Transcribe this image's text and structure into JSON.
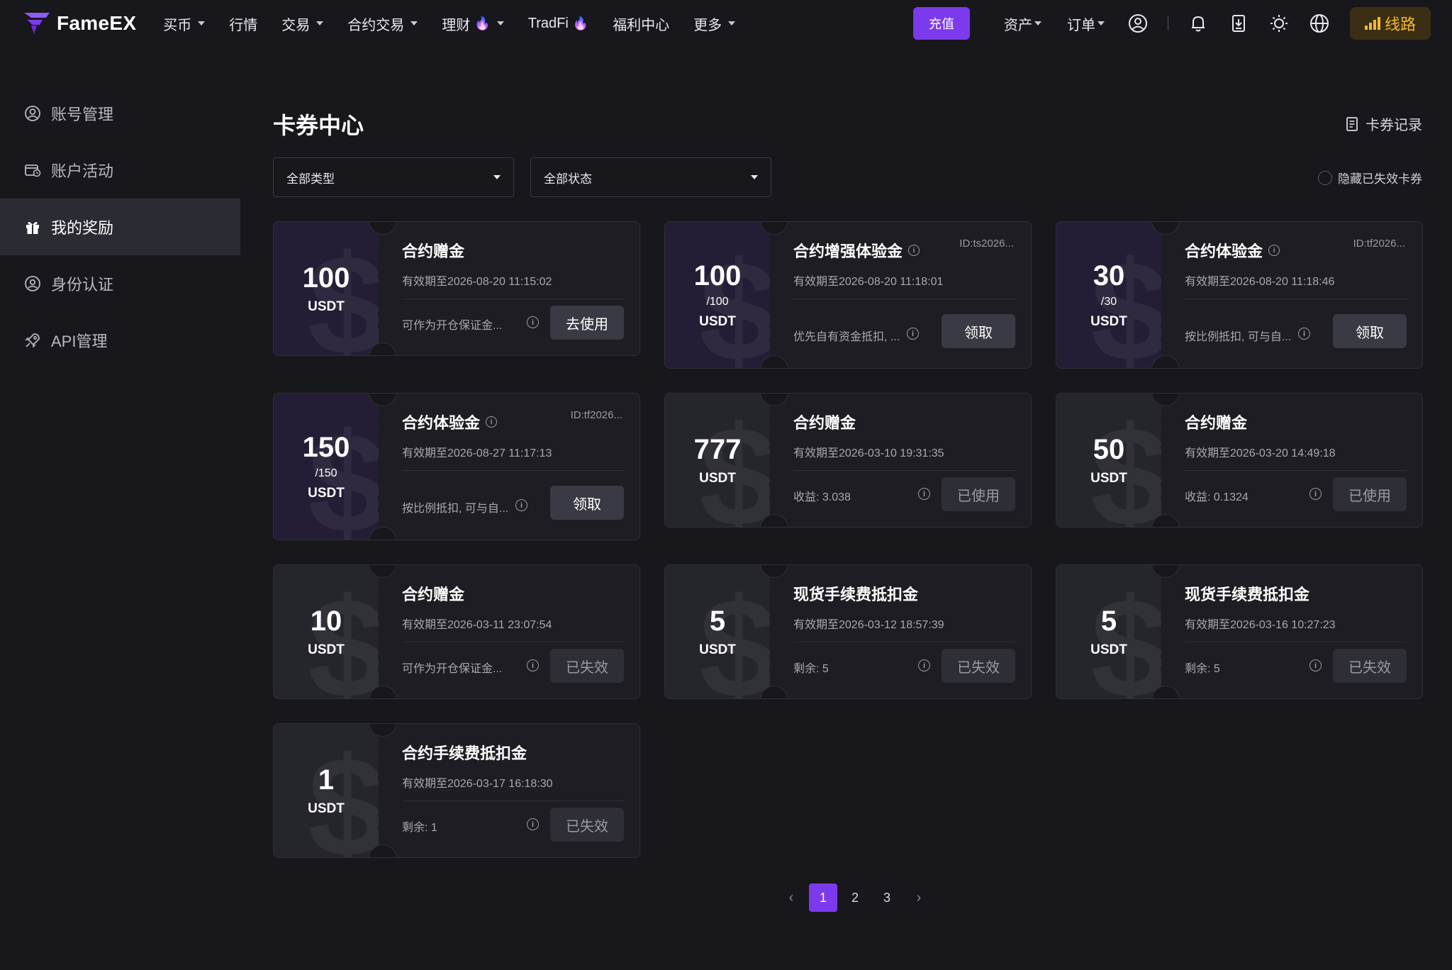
{
  "nav": {
    "logo": "FameEX",
    "items": [
      {
        "label": "买币",
        "caret": true,
        "flame": false
      },
      {
        "label": "行情",
        "caret": false,
        "flame": false
      },
      {
        "label": "交易",
        "caret": true,
        "flame": false
      },
      {
        "label": "合约交易",
        "caret": true,
        "flame": false
      },
      {
        "label": "理财",
        "caret": true,
        "flame": true
      },
      {
        "label": "TradFi",
        "caret": false,
        "flame": true
      },
      {
        "label": "福利中心",
        "caret": false,
        "flame": false
      },
      {
        "label": "更多",
        "caret": true,
        "flame": false
      }
    ],
    "deposit": "充值",
    "assets": "资产",
    "orders": "订单",
    "route": "线路"
  },
  "sidebar": {
    "items": [
      {
        "label": "账号管理",
        "icon": "user-circle-icon",
        "active": false
      },
      {
        "label": "账户活动",
        "icon": "wallet-clock-icon",
        "active": false
      },
      {
        "label": "我的奖励",
        "icon": "gift-icon",
        "active": true
      },
      {
        "label": "身份认证",
        "icon": "id-verify-icon",
        "active": false
      },
      {
        "label": "API管理",
        "icon": "rocket-icon",
        "active": false
      }
    ]
  },
  "main": {
    "title": "卡券中心",
    "records": "卡券记录",
    "filter_type": "全部类型",
    "filter_status": "全部状态",
    "hide_expired": "隐藏已失效卡券"
  },
  "coupons": [
    {
      "amount": "100",
      "sub": "",
      "unit": "USDT",
      "title": "合约赠金",
      "title_info": false,
      "id": "",
      "expire": "有效期至2026-08-20 11:15:02",
      "desc": "可作为开仓保证金...",
      "button": "去使用",
      "state": "active",
      "style": "unclaimed"
    },
    {
      "amount": "100",
      "sub": "/100",
      "unit": "USDT",
      "title": "合约增强体验金",
      "title_info": true,
      "id": "ID:ts2026...",
      "expire": "有效期至2026-08-20 11:18:01",
      "desc": "优先自有资金抵扣, ...",
      "button": "领取",
      "state": "active",
      "style": "unclaimed"
    },
    {
      "amount": "30",
      "sub": "/30",
      "unit": "USDT",
      "title": "合约体验金",
      "title_info": true,
      "id": "ID:tf2026...",
      "expire": "有效期至2026-08-20 11:18:46",
      "desc": "按比例抵扣, 可与自...",
      "button": "领取",
      "state": "active",
      "style": "unclaimed"
    },
    {
      "amount": "150",
      "sub": "/150",
      "unit": "USDT",
      "title": "合约体验金",
      "title_info": true,
      "id": "ID:tf2026...",
      "expire": "有效期至2026-08-27 11:17:13",
      "desc": "按比例抵扣, 可与自...",
      "button": "领取",
      "state": "active",
      "style": "unclaimed"
    },
    {
      "amount": "777",
      "sub": "",
      "unit": "USDT",
      "title": "合约赠金",
      "title_info": false,
      "id": "",
      "expire": "有效期至2026-03-10 19:31:35",
      "desc": "收益: 3.038",
      "button": "已使用",
      "state": "disabled",
      "style": "used"
    },
    {
      "amount": "50",
      "sub": "",
      "unit": "USDT",
      "title": "合约赠金",
      "title_info": false,
      "id": "",
      "expire": "有效期至2026-03-20 14:49:18",
      "desc": "收益: 0.1324",
      "button": "已使用",
      "state": "disabled",
      "style": "used"
    },
    {
      "amount": "10",
      "sub": "",
      "unit": "USDT",
      "title": "合约赠金",
      "title_info": false,
      "id": "",
      "expire": "有效期至2026-03-11 23:07:54",
      "desc": "可作为开仓保证金...",
      "button": "已失效",
      "state": "disabled",
      "style": "used"
    },
    {
      "amount": "5",
      "sub": "",
      "unit": "USDT",
      "title": "现货手续费抵扣金",
      "title_info": false,
      "id": "",
      "expire": "有效期至2026-03-12 18:57:39",
      "desc": "剩余: 5",
      "button": "已失效",
      "state": "disabled",
      "style": "used"
    },
    {
      "amount": "5",
      "sub": "",
      "unit": "USDT",
      "title": "现货手续费抵扣金",
      "title_info": false,
      "id": "",
      "expire": "有效期至2026-03-16 10:27:23",
      "desc": "剩余: 5",
      "button": "已失效",
      "state": "disabled",
      "style": "used"
    },
    {
      "amount": "1",
      "sub": "",
      "unit": "USDT",
      "title": "合约手续费抵扣金",
      "title_info": false,
      "id": "",
      "expire": "有效期至2026-03-17 16:18:30",
      "desc": "剩余: 1",
      "button": "已失效",
      "state": "disabled",
      "style": "used"
    }
  ],
  "pagination": {
    "prev": "‹",
    "pages": [
      "1",
      "2",
      "3"
    ],
    "current": "1",
    "next": "›"
  },
  "colors": {
    "accent": "#7c3aed",
    "background": "#17171c",
    "route": "#f5b731"
  }
}
